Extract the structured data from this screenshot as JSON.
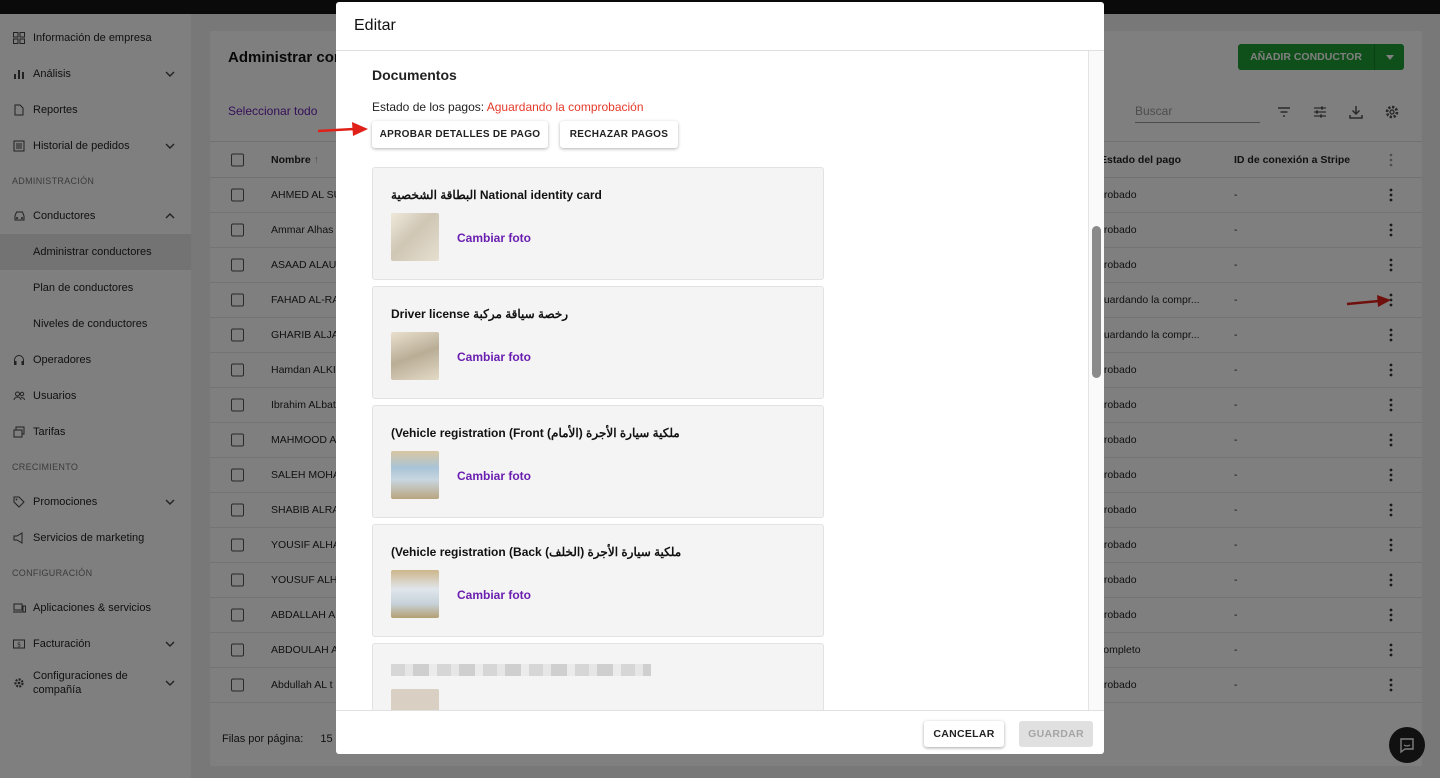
{
  "sidebar": {
    "items": [
      {
        "label": "Información de empresa",
        "icon": "grid-icon"
      },
      {
        "label": "Análisis",
        "icon": "bar-chart-icon",
        "chevron": "down"
      },
      {
        "label": "Reportes",
        "icon": "document-icon"
      },
      {
        "label": "Historial de pedidos",
        "icon": "list-icon",
        "chevron": "down"
      }
    ],
    "section_admin": "ADMINISTRACIÓN",
    "conductores": "Conductores",
    "administrar_conductores": "Administrar conductores",
    "plan_conductores": "Plan de conductores",
    "niveles_conductores": "Niveles de conductores",
    "operadores": "Operadores",
    "usuarios": "Usuarios",
    "tarifas": "Tarifas",
    "section_growth": "CRECIMIENTO",
    "promociones": "Promociones",
    "marketing": "Servicios de marketing",
    "section_config": "CONFIGURACIÓN",
    "apps": "Aplicaciones & servicios",
    "facturacion": "Facturación",
    "config_compania_1": "Configuraciones de",
    "config_compania_2": "compañía"
  },
  "page": {
    "title": "Administrar con",
    "add_button": "AÑADIR CONDUCTOR",
    "select_all": "Seleccionar todo",
    "search_placeholder": "Buscar",
    "col_name": "Nombre",
    "col_payment_status": "Estado del pago",
    "col_stripe": "ID de conexión a Stripe",
    "rows_per_page_label": "Filas por página:",
    "rows_per_page_value": "15"
  },
  "rows": [
    {
      "name": "AHMED AL SU",
      "status": "probado",
      "stripe": "-"
    },
    {
      "name": "Ammar Alhas",
      "status": "probado",
      "stripe": "-"
    },
    {
      "name": "ASAAD ALAUL",
      "status": "probado",
      "stripe": "-"
    },
    {
      "name": "FAHAD AL-RA",
      "status": "guardando la compr...",
      "stripe": "-"
    },
    {
      "name": "GHARIB ALJA",
      "status": "guardando la compr...",
      "stripe": "-"
    },
    {
      "name": "Hamdan ALKI",
      "status": "probado",
      "stripe": "-"
    },
    {
      "name": "Ibrahim ALbat",
      "status": "probado",
      "stripe": "-"
    },
    {
      "name": "MAHMOOD A",
      "status": "probado",
      "stripe": "-"
    },
    {
      "name": "SALEH MOHA",
      "status": "probado",
      "stripe": "-"
    },
    {
      "name": "SHABIB ALRA",
      "status": "probado",
      "stripe": "-"
    },
    {
      "name": "YOUSIF ALHA",
      "status": "probado",
      "stripe": "-"
    },
    {
      "name": "YOUSUF ALHA",
      "status": "probado",
      "stripe": "-"
    },
    {
      "name": "ABDALLAH AL",
      "status": "probado",
      "stripe": "-"
    },
    {
      "name": "ABDOULAH A",
      "status": "completo",
      "stripe": "-"
    },
    {
      "name": "Abdullah AL t",
      "status": "probado",
      "stripe": "-"
    }
  ],
  "modal": {
    "title": "Editar",
    "section_title": "Documentos",
    "payment_status_label": "Estado de los pagos:",
    "payment_status_value": "Aguardando la comprobación",
    "approve_button": "APROBAR DETALLES DE PAGO",
    "reject_button": "RECHAZAR PAGOS",
    "documents": [
      {
        "title": "البطاقة الشخصية National identity card",
        "link": "Cambiar foto"
      },
      {
        "title": "Driver license رخصة سياقة مركبة",
        "link": "Cambiar foto"
      },
      {
        "title": "(Vehicle registration (Front ملكية سيارة الأجرة (الأمام)",
        "link": "Cambiar foto"
      },
      {
        "title": "(Vehicle registration (Back ملكية سيارة الأجرة (الخلف)",
        "link": "Cambiar foto"
      }
    ],
    "cancel_button": "CANCELAR",
    "save_button": "GUARDAR"
  },
  "colors": {
    "accent_purple": "#6a1fb0",
    "brand_green": "#1e9e34",
    "status_red": "#e53a2a",
    "annotation_arrow": "#e0211a"
  }
}
